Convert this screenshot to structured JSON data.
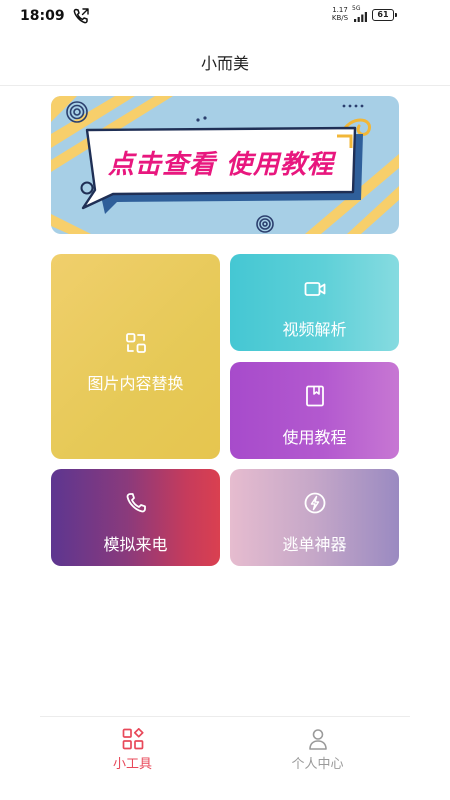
{
  "status_bar": {
    "time": "18:09",
    "net_speed_value": "1.17",
    "net_speed_unit": "KB/S",
    "network_type": "5G",
    "battery": "61"
  },
  "header": {
    "title": "小而美"
  },
  "banner": {
    "text": "点击查看 使用教程"
  },
  "tools": {
    "image_replace": {
      "label": "图片内容替换",
      "icon": "image-swap-icon"
    },
    "video_parse": {
      "label": "视频解析",
      "icon": "video-camera-icon"
    },
    "tutorial": {
      "label": "使用教程",
      "icon": "bookmark-icon"
    },
    "fake_call": {
      "label": "模拟来电",
      "icon": "phone-icon"
    },
    "escape_tool": {
      "label": "逃单神器",
      "icon": "lightning-icon"
    }
  },
  "bottom_nav": {
    "tools": {
      "label": "小工具",
      "active": true,
      "color": "#e8495a"
    },
    "profile": {
      "label": "个人中心",
      "active": false,
      "color": "#9a9a9a"
    }
  }
}
